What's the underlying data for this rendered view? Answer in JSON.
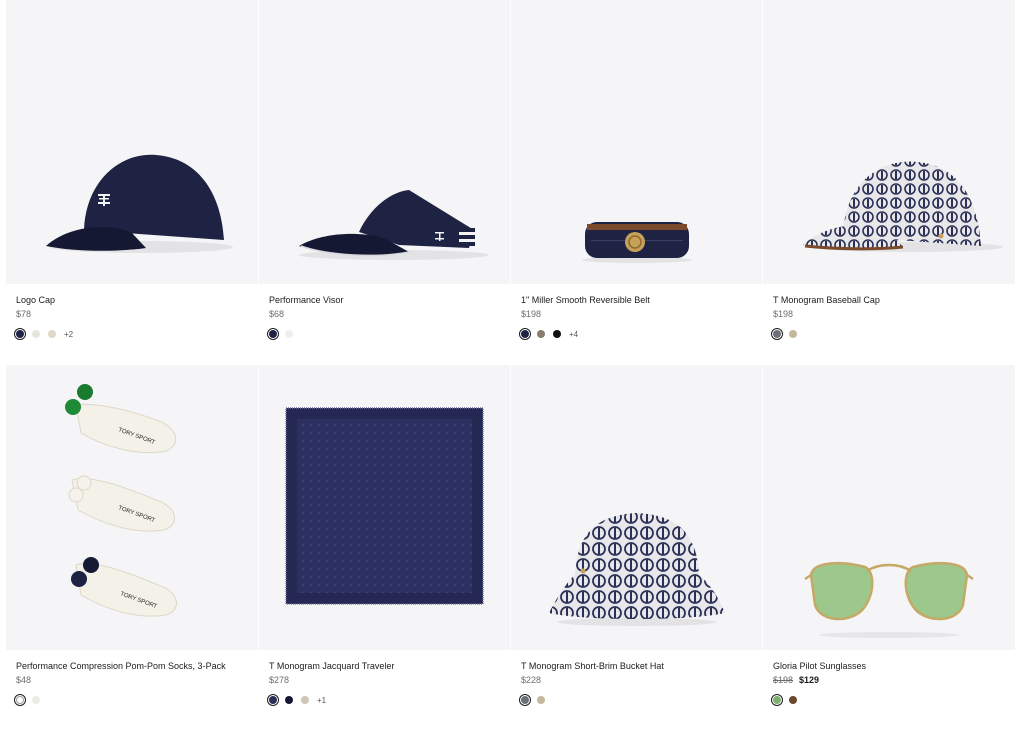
{
  "products": [
    {
      "name": "Logo Cap",
      "price": "$78",
      "old_price": "",
      "sale_price": "",
      "swatches": [
        "#1f2446",
        "#e7e4dc",
        "#e0d9c5"
      ],
      "more": "+2"
    },
    {
      "name": "Performance Visor",
      "price": "$68",
      "old_price": "",
      "sale_price": "",
      "swatches": [
        "#1f2446",
        "#eeeef2"
      ],
      "more": ""
    },
    {
      "name": "1\" Miller Smooth Reversible Belt",
      "price": "$198",
      "old_price": "",
      "sale_price": "",
      "swatches": [
        "#1f2446",
        "#8a7d6d",
        "#111111"
      ],
      "more": "+4"
    },
    {
      "name": "T Monogram Baseball Cap",
      "price": "$198",
      "old_price": "",
      "sale_price": "",
      "swatches": [
        "#6b6f78",
        "#c4b79c"
      ],
      "more": ""
    },
    {
      "name": "Performance Compression Pom-Pom Socks, 3-Pack",
      "price": "$48",
      "old_price": "",
      "sale_price": "",
      "swatches": [
        "#ffffff",
        "#ebebe6"
      ],
      "more": ""
    },
    {
      "name": "T Monogram Jacquard Traveler",
      "price": "$278",
      "old_price": "",
      "sale_price": "",
      "swatches": [
        "#2a2f55",
        "#151833",
        "#cfc6b4"
      ],
      "more": "+1"
    },
    {
      "name": "T Monogram Short-Brim Bucket Hat",
      "price": "$228",
      "old_price": "",
      "sale_price": "",
      "swatches": [
        "#6b6f78",
        "#c4b79c"
      ],
      "more": ""
    },
    {
      "name": "Gloria Pilot Sunglasses",
      "price": "",
      "old_price": "$198",
      "sale_price": "$129",
      "swatches": [
        "#7fae6f",
        "#6a4a2a"
      ],
      "more": ""
    }
  ]
}
